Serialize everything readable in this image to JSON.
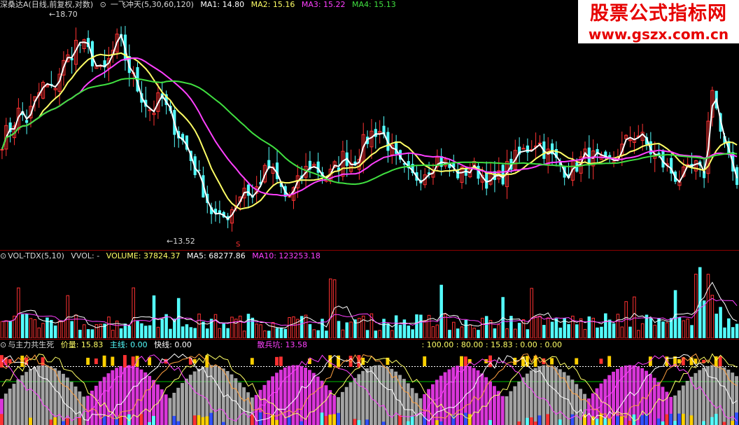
{
  "price_panel": {
    "stock_name": "深桑达A",
    "period_info": "(日线,前复权,对数)",
    "indicator_name": "一飞冲天(5,30,60,120)",
    "ma1": "MA1: 14.80",
    "ma2": "MA2: 15.16",
    "ma3": "MA3: 15.22",
    "ma4": "MA4: 15.13",
    "high_label": "18.70",
    "low_label": "13.52",
    "signal_mark": "S"
  },
  "volume_panel": {
    "indicator_name": "VOL-TDX(5,10)",
    "vvol": "VVOL: -",
    "volume": "VOLUME: 37824.37",
    "ma5": "MA5: 68277.86",
    "ma10": "MA10: 123253.18"
  },
  "bottom_panel": {
    "indicator_name": "与主力共生死",
    "price_line": "价量: 15.83",
    "main_line": "主线: 0.00",
    "fast_line": "快线: 0.00",
    "retail": "散兵坑: 13.58",
    "levels": ": 100.00 : 80.00 : 15.83 : 0.00 : 0.00"
  },
  "watermark": {
    "title": "股票公式指标网",
    "url": "www.gszx.com.cn"
  },
  "colors": {
    "up": "#ff3232",
    "down": "#54ffff",
    "ma1": "#ffffff",
    "ma2": "#ffff66",
    "ma3": "#ff40ff",
    "ma4": "#40e040",
    "label": "#c0c0c0",
    "separator": "#8b0000"
  },
  "chart_data": [
    {
      "type": "candlestick",
      "title": "深桑达A",
      "series_ma": [
        "MA1",
        "MA2",
        "MA3",
        "MA4"
      ],
      "ma_last": [
        14.8,
        15.16,
        15.22,
        15.13
      ],
      "visible_high": 18.7,
      "visible_low": 13.52,
      "closes": [
        15.8,
        16.1,
        16.5,
        16.3,
        16.8,
        17.2,
        17.0,
        17.6,
        17.9,
        18.3,
        18.1,
        17.8,
        17.4,
        17.9,
        18.4,
        17.7,
        17.2,
        16.8,
        16.5,
        16.9,
        16.4,
        16.0,
        15.6,
        15.1,
        14.6,
        14.0,
        13.7,
        13.9,
        14.2,
        14.6,
        14.3,
        14.8,
        15.1,
        14.7,
        14.3,
        14.5,
        14.9,
        15.2,
        15.0,
        14.8,
        15.1,
        15.4,
        15.2,
        15.6,
        15.9,
        16.1,
        15.8,
        15.3,
        15.0,
        14.8,
        14.9,
        15.1,
        15.3,
        15.2,
        15.0,
        14.9,
        15.1,
        15.0,
        14.8,
        14.7,
        14.9,
        15.2,
        15.4,
        15.6,
        15.8,
        15.5,
        15.3,
        15.1,
        15.0,
        15.2,
        15.4,
        15.3,
        15.1,
        15.2,
        15.5,
        15.8,
        16.0,
        15.7,
        15.4,
        15.2,
        15.0,
        14.8,
        14.9,
        15.1,
        14.8,
        17.3,
        16.0,
        15.2,
        14.8
      ],
      "ylim": [
        13.2,
        19.0
      ]
    },
    {
      "type": "bar",
      "title": "VOL-TDX(5,10)",
      "last_volume": 37824.37,
      "ma5": 68277.86,
      "ma10": 123253.18
    },
    {
      "type": "area",
      "title": "与主力共生死",
      "price_line": 15.83,
      "main_line": 0.0,
      "fast_line": 0.0,
      "retail": 13.58,
      "levels": [
        100.0,
        80.0,
        15.83,
        0.0,
        0.0
      ]
    }
  ]
}
